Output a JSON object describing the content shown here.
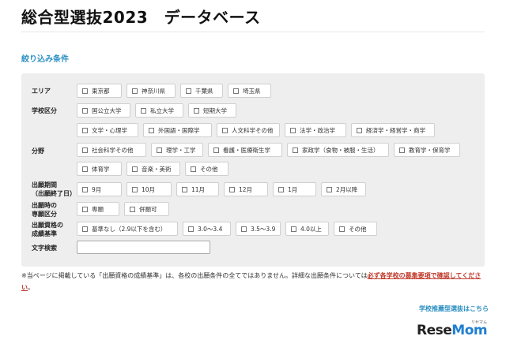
{
  "header": {
    "title": "総合型選抜2023　データベース"
  },
  "filter": {
    "heading": "絞り込み条件",
    "rows": {
      "area": {
        "label": [
          "エリア"
        ],
        "options": [
          "東京都",
          "神奈川県",
          "千葉県",
          "埼玉県"
        ]
      },
      "school_type": {
        "label": [
          "学校区分"
        ],
        "options": [
          "国公立大学",
          "私立大学",
          "短期大学"
        ]
      },
      "field": {
        "label": [
          "分野"
        ],
        "options": [
          "文学・心理学",
          "外国語・国際学",
          "人文科学その他",
          "法学・政治学",
          "経済学・経営学・商学",
          "社会科学その他",
          "理学・工学",
          "看護・医療衛生学",
          "家政学（食物・被服・生活）",
          "教育学・保育学",
          "体育学",
          "音楽・美術",
          "その他"
        ]
      },
      "period": {
        "label": [
          "出願期間",
          "（出願終了日）"
        ],
        "options": [
          "9月",
          "10月",
          "11月",
          "12月",
          "1月",
          "2月以降"
        ]
      },
      "division": {
        "label": [
          "出願時の",
          "専願区分"
        ],
        "options": [
          "専願",
          "併願可"
        ]
      },
      "grade": {
        "label": [
          "出願資格の",
          "成績基準"
        ],
        "options": [
          "基準なし（2.9以下を含む）",
          "3.0〜3.4",
          "3.5〜3.9",
          "4.0以上",
          "その他"
        ]
      },
      "keyword": {
        "label": [
          "文字検索"
        ],
        "value": ""
      }
    }
  },
  "notice": {
    "text": "※当ページに掲載している「出願資格の成績基準」は、各校の出願条件の全てではありません。詳細な出願条件については",
    "emphasis": "必ず各学校の募集要項で確認してください",
    "end": "。"
  },
  "footer": {
    "link": "学校推薦型選抜はこちら"
  },
  "logo": {
    "prefix": "Rese",
    "suffix": "Mom",
    "sub": "リセマム"
  },
  "colors": {
    "accent": "#2a8ec2",
    "emphasis": "#c0392b",
    "panel": "#eeeeee"
  }
}
